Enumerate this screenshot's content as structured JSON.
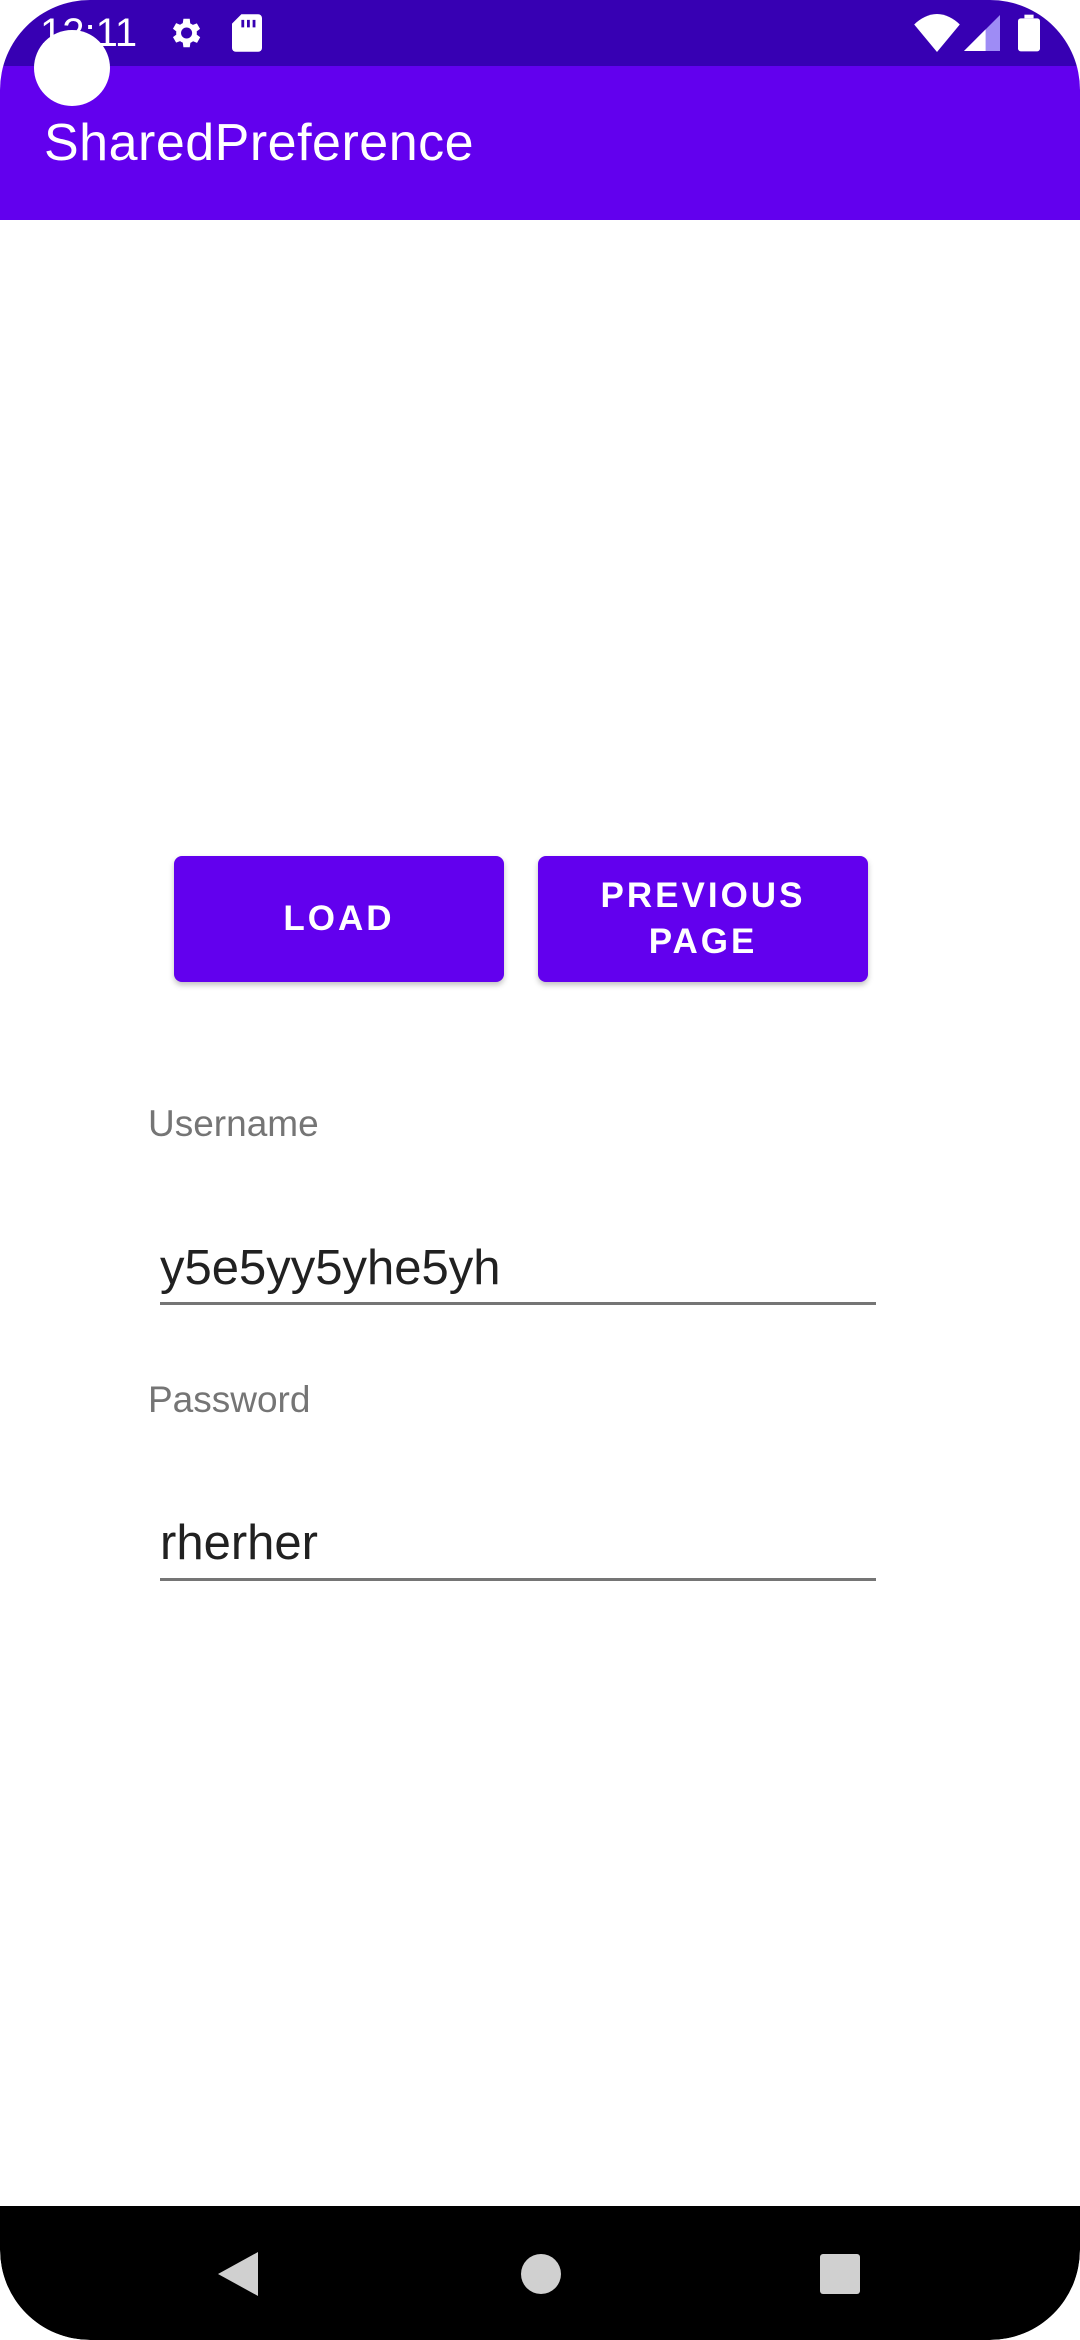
{
  "status_bar": {
    "time": "12:11",
    "icons": [
      "gear-icon",
      "sd-card-icon",
      "wifi-icon",
      "signal-icon",
      "battery-icon"
    ]
  },
  "app_bar": {
    "title": "SharedPreference",
    "color": "#6200ee"
  },
  "buttons": {
    "load_label": "LOAD",
    "previous_label": "PREVIOUS PAGE"
  },
  "form": {
    "username_label": "Username",
    "username_value": "y5e5yy5yhe5yh",
    "password_label": "Password",
    "password_value": "rherher"
  },
  "nav_bar": {
    "icons": [
      "back-icon",
      "home-icon",
      "recents-icon"
    ]
  },
  "colors": {
    "primary": "#6200ee",
    "primary_dark": "#3700b3"
  }
}
